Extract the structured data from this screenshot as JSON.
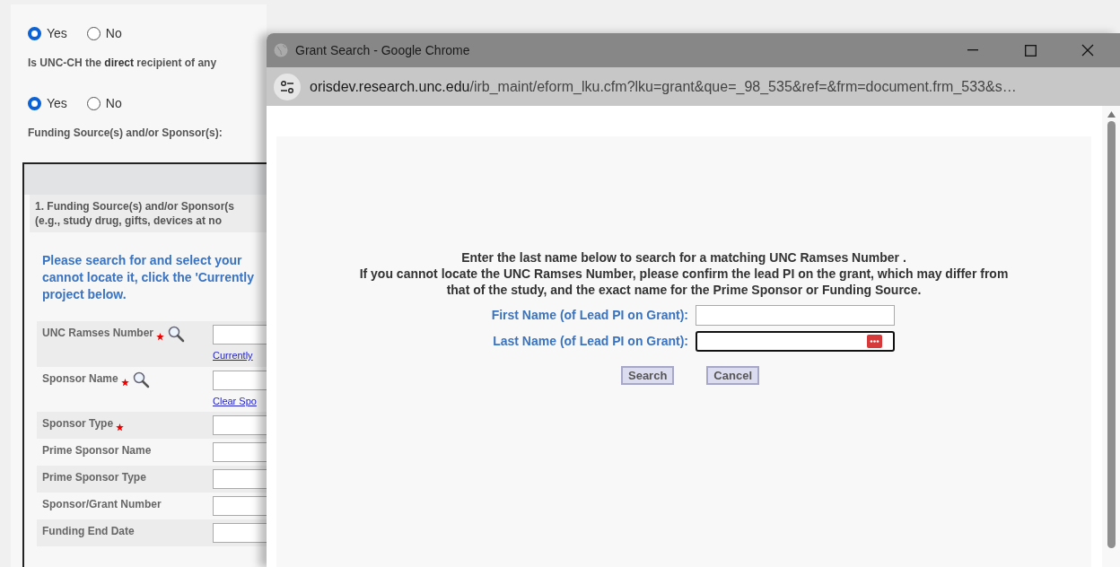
{
  "form": {
    "items": [
      {
        "kind": "radios",
        "options": [
          {
            "label": "Yes",
            "selected": true
          },
          {
            "label": "No",
            "selected": false
          }
        ]
      },
      {
        "kind": "question",
        "text": "Is UNC-CH the **direct** recipient of any"
      },
      {
        "kind": "radios",
        "options": [
          {
            "label": "Yes",
            "selected": true
          },
          {
            "label": "No",
            "selected": false
          }
        ]
      },
      {
        "kind": "question",
        "text": "Funding Source(s) and/or Sponsor(s):"
      }
    ],
    "section": {
      "heading_lines": [
        "1. Funding Source(s) and/or Sponsor(s",
        "(e.g., study drug, gifts, devices at no"
      ],
      "instructions": [
        "Please search for and select your",
        "cannot locate it, click the 'Currently",
        "project below."
      ],
      "fields": [
        {
          "label": "UNC Ramses Number",
          "required": true,
          "searchable": true,
          "link": "Currently"
        },
        {
          "label": "Sponsor Name",
          "required": true,
          "searchable": true,
          "link": "Clear Spo"
        },
        {
          "label": "Sponsor Type",
          "required": true,
          "searchable": false
        },
        {
          "label": "Prime Sponsor Name",
          "required": false,
          "searchable": false
        },
        {
          "label": "Prime Sponsor Type",
          "required": false,
          "searchable": false
        },
        {
          "label": "Sponsor/Grant Number",
          "required": false,
          "searchable": false
        },
        {
          "label": "Funding End Date",
          "required": false,
          "searchable": false
        }
      ]
    }
  },
  "popup": {
    "title": "Grant Search - Google Chrome",
    "url_host": "orisdev.research.unc.edu",
    "url_path": "/irb_maint/eform_lku.cfm?lku=grant&que=_98_535&ref=&frm=document.frm_533&s…",
    "instructions": [
      "Enter the last name below to search for a matching UNC Ramses Number .",
      "If you cannot locate the UNC Ramses Number, please confirm the lead PI on the grant, which may differ from",
      "that of the study, and the exact name for the Prime Sponsor or Funding Source."
    ],
    "fields": [
      {
        "label": "First Name (of Lead PI on Grant):",
        "focused": false,
        "autofill": false
      },
      {
        "label": "Last Name (of Lead PI on Grant):",
        "focused": true,
        "autofill": true
      }
    ],
    "buttons": [
      "Search",
      "Cancel"
    ]
  }
}
